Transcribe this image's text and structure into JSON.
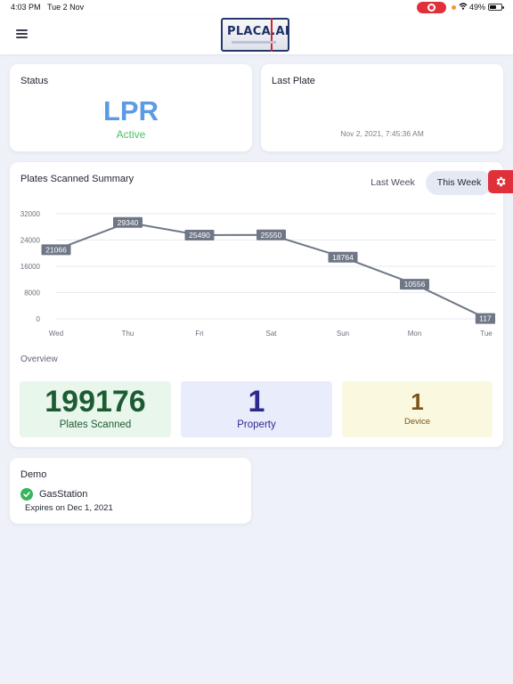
{
  "statusbar": {
    "time": "4:03 PM",
    "date": "Tue 2 Nov",
    "battery": "49%"
  },
  "header": {
    "logo_text": "PLACA.AI"
  },
  "status_card": {
    "title": "Status",
    "value": "LPR",
    "state": "Active"
  },
  "last_plate_card": {
    "title": "Last Plate",
    "timestamp": "Nov 2, 2021, 7:45:36 AM"
  },
  "summary": {
    "title": "Plates Scanned Summary",
    "tabs": {
      "last_week": "Last Week",
      "this_week": "This Week"
    },
    "overview_label": "Overview",
    "tiles": {
      "plates": {
        "value": "199176",
        "label": "Plates Scanned"
      },
      "property": {
        "value": "1",
        "label": "Property"
      },
      "device": {
        "value": "1",
        "label": "Device"
      }
    }
  },
  "chart_data": {
    "type": "line",
    "categories": [
      "Wed",
      "Thu",
      "Fri",
      "Sat",
      "Sun",
      "Mon",
      "Tue"
    ],
    "values": [
      21066,
      29340,
      25490,
      25550,
      18764,
      10556,
      117
    ],
    "data_labels": [
      "21066",
      "29340",
      "25490",
      "25550",
      "18764",
      "10556",
      "117"
    ],
    "ylim": [
      0,
      32000
    ],
    "yticks": [
      "0",
      "8000",
      "16000",
      "24000",
      "32000"
    ],
    "grid": true,
    "line_color": "#6f7787"
  },
  "demo_card": {
    "title": "Demo",
    "name": "GasStation",
    "expires": "Expires on Dec 1, 2021"
  },
  "colors": {
    "accent": "#5c9ae6",
    "active": "#4bbf62",
    "settings": "#e0303a"
  }
}
